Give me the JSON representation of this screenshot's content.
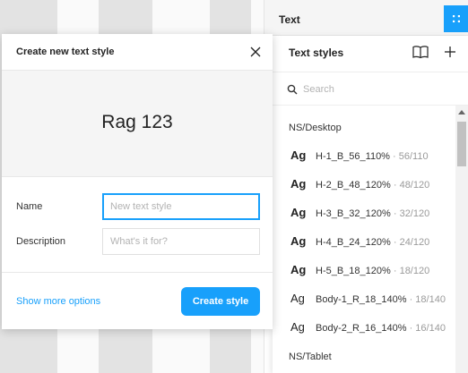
{
  "right_panel": {
    "section_title": "Text",
    "grid_icon": "grid-dots-icon",
    "accent": "#18a0fb"
  },
  "text_styles": {
    "title": "Text styles",
    "search_placeholder": "Search",
    "groups": [
      {
        "title": "NS/Desktop",
        "items": [
          {
            "preview": "Ag",
            "bold": true,
            "name": "H-1_B_56_110%",
            "meta": " · 56/110"
          },
          {
            "preview": "Ag",
            "bold": true,
            "name": "H-2_B_48_120%",
            "meta": " · 48/120"
          },
          {
            "preview": "Ag",
            "bold": true,
            "name": "H-3_B_32_120%",
            "meta": " · 32/120"
          },
          {
            "preview": "Ag",
            "bold": true,
            "name": "H-4_B_24_120%",
            "meta": " · 24/120"
          },
          {
            "preview": "Ag",
            "bold": true,
            "name": "H-5_B_18_120%",
            "meta": " · 18/120"
          },
          {
            "preview": "Ag",
            "bold": false,
            "name": "Body-1_R_18_140%",
            "meta": " · 18/140"
          },
          {
            "preview": "Ag",
            "bold": false,
            "name": "Body-2_R_16_140%",
            "meta": " · 16/140"
          }
        ]
      },
      {
        "title": "NS/Tablet",
        "items": []
      }
    ]
  },
  "modal": {
    "title": "Create new text style",
    "preview_text": "Rag 123",
    "name_label": "Name",
    "name_placeholder": "New text style",
    "description_label": "Description",
    "description_placeholder": "What's it for?",
    "more_options": "Show more options",
    "create_button": "Create style"
  }
}
